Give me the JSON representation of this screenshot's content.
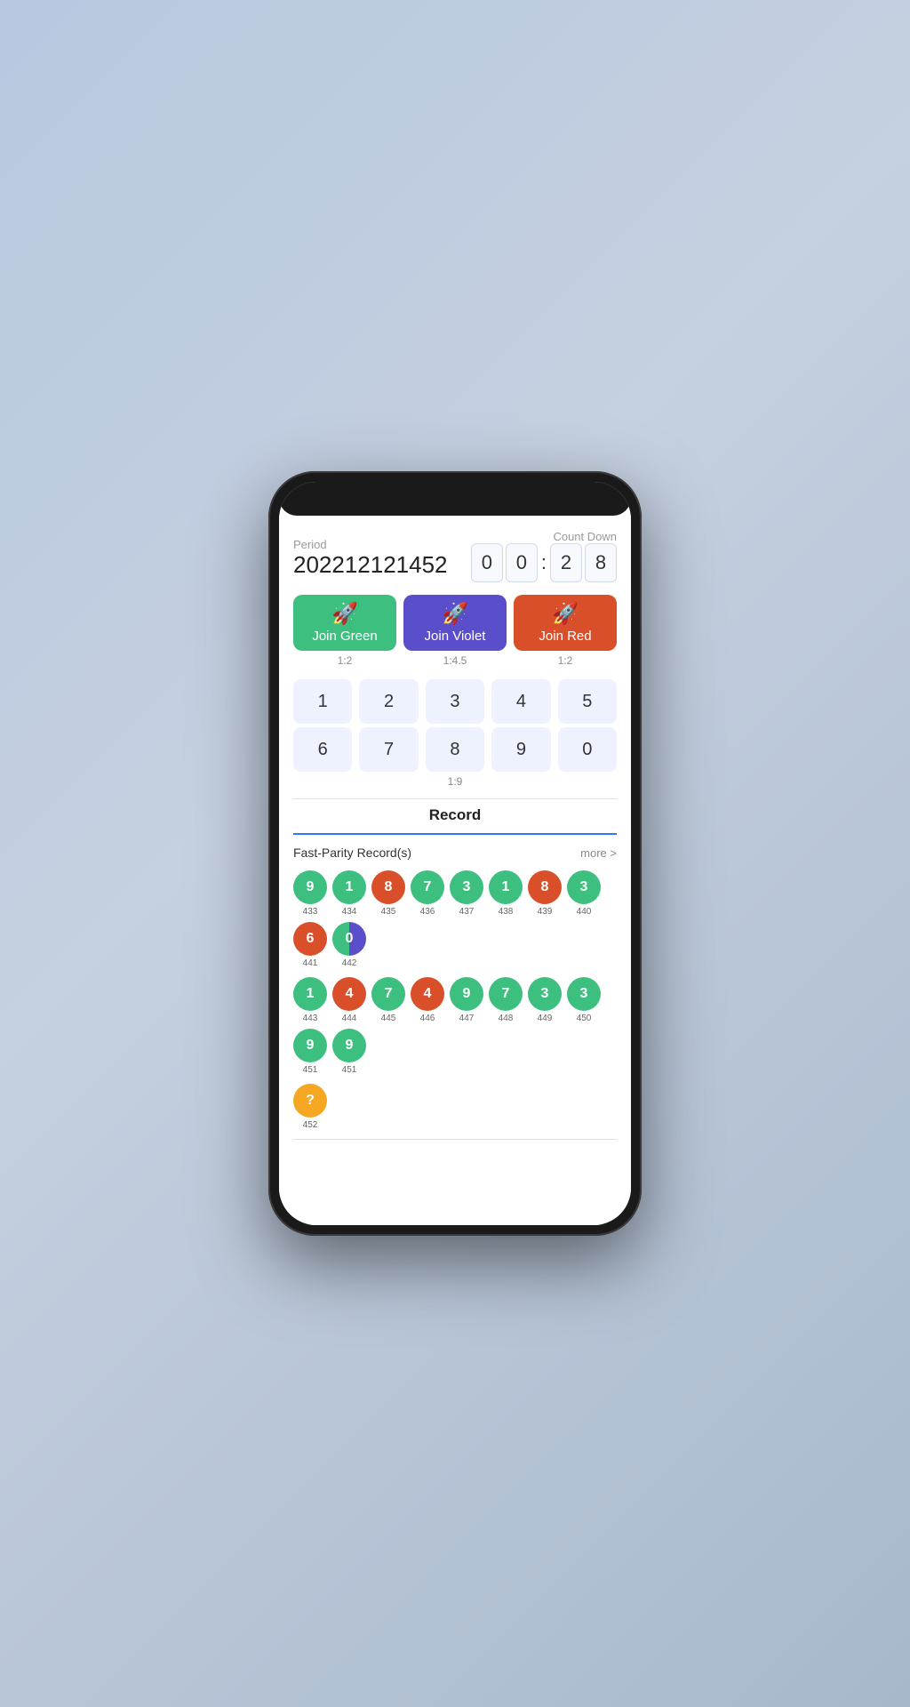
{
  "header": {
    "period_label": "Period",
    "countdown_label": "Count Down",
    "period_value": "202212121452",
    "countdown": [
      "0",
      "0",
      "2",
      "8"
    ]
  },
  "join_buttons": [
    {
      "id": "green",
      "label": "Join Green",
      "ratio": "1:2",
      "color": "green"
    },
    {
      "id": "violet",
      "label": "Join Violet",
      "ratio": "1:4.5",
      "color": "violet"
    },
    {
      "id": "red",
      "label": "Join Red",
      "ratio": "1:2",
      "color": "red"
    }
  ],
  "number_grid": {
    "row1": [
      "1",
      "2",
      "3",
      "4",
      "5"
    ],
    "row2": [
      "6",
      "7",
      "8",
      "9",
      "0"
    ],
    "ratio": "1:9"
  },
  "record": {
    "title": "Record",
    "subtitle": "Fast-Parity Record(s)",
    "more_label": "more >",
    "rows": [
      {
        "circles": [
          {
            "value": "9",
            "type": "green",
            "seq": "433"
          },
          {
            "value": "1",
            "type": "green",
            "seq": "434"
          },
          {
            "value": "8",
            "type": "red",
            "seq": "435"
          },
          {
            "value": "7",
            "type": "green",
            "seq": "436"
          },
          {
            "value": "3",
            "type": "green",
            "seq": "437"
          },
          {
            "value": "1",
            "type": "green",
            "seq": "438"
          },
          {
            "value": "8",
            "type": "red",
            "seq": "439"
          },
          {
            "value": "3",
            "type": "green",
            "seq": "440"
          },
          {
            "value": "6",
            "type": "red",
            "seq": "441"
          },
          {
            "value": "0",
            "type": "half-violet",
            "seq": "442"
          }
        ]
      },
      {
        "circles": [
          {
            "value": "1",
            "type": "green",
            "seq": "443"
          },
          {
            "value": "4",
            "type": "red",
            "seq": "444"
          },
          {
            "value": "7",
            "type": "green",
            "seq": "445"
          },
          {
            "value": "4",
            "type": "red",
            "seq": "446"
          },
          {
            "value": "9",
            "type": "green",
            "seq": "447"
          },
          {
            "value": "7",
            "type": "green",
            "seq": "448"
          },
          {
            "value": "3",
            "type": "green",
            "seq": "449"
          },
          {
            "value": "3",
            "type": "green",
            "seq": "450"
          },
          {
            "value": "9",
            "type": "green",
            "seq": "451"
          },
          {
            "value": "9",
            "type": "green",
            "seq": "451"
          }
        ]
      },
      {
        "circles": [
          {
            "value": "?",
            "type": "orange",
            "seq": "452"
          }
        ]
      }
    ]
  }
}
